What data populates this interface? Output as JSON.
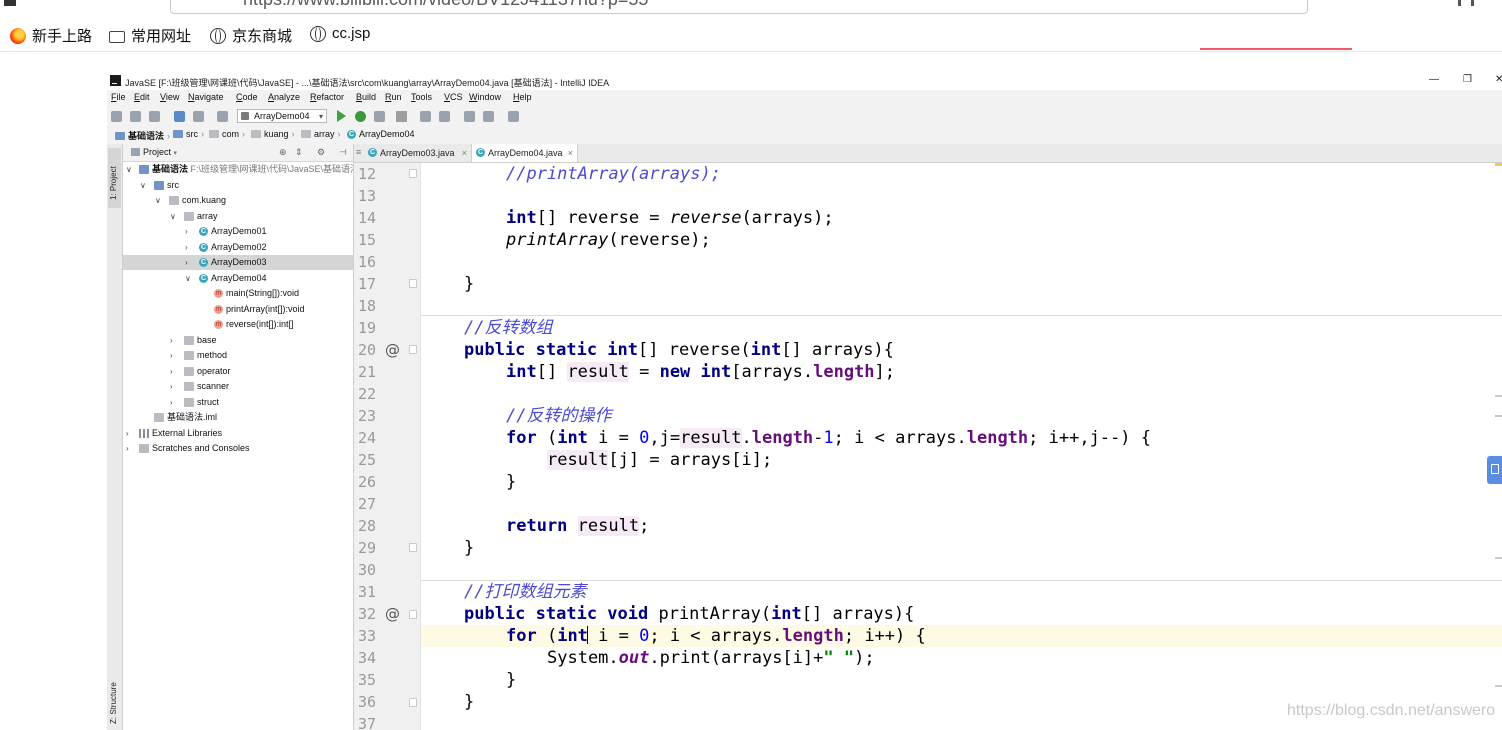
{
  "browser": {
    "url": "https://www.bilibili.com/video/BV12J41137hu?p=55",
    "bookmarks": [
      "新手上路",
      "常用网址",
      "京东商城",
      "cc.jsp"
    ]
  },
  "ide": {
    "title": "JavaSE [F:\\班级管理\\网课班\\代码\\JavaSE] - ...\\基础语法\\src\\com\\kuang\\array\\ArrayDemo04.java [基础语法] - IntelliJ IDEA",
    "window_buttons": [
      "—",
      "❐",
      "✕"
    ],
    "menu": [
      "File",
      "Edit",
      "View",
      "Navigate",
      "Code",
      "Analyze",
      "Refactor",
      "Build",
      "Run",
      "Tools",
      "VCS",
      "Window",
      "Help"
    ],
    "run_config": "ArrayDemo04",
    "breadcrumbs": [
      "基础语法",
      "src",
      "com",
      "kuang",
      "array",
      "ArrayDemo04"
    ],
    "side_tabs": {
      "project": "1: Project",
      "structure": "Z: Structure"
    },
    "project_panel": {
      "title": "Project",
      "root_name": "基础语法",
      "root_path": "F:\\班级管理\\网课班\\代码\\JavaSE\\基础语法",
      "src": "src",
      "package": "com.kuang",
      "array_pkg": "array",
      "classes": [
        "ArrayDemo01",
        "ArrayDemo02",
        "ArrayDemo03",
        "ArrayDemo04"
      ],
      "selected": "ArrayDemo03",
      "methods": [
        "main(String[]):void",
        "printArray(int[]):void",
        "reverse(int[]):int[]"
      ],
      "packages": [
        "base",
        "method",
        "operator",
        "scanner",
        "struct"
      ],
      "iml": "基础语法.iml",
      "external": "External Libraries",
      "scratches": "Scratches and Consoles"
    },
    "tabs": [
      {
        "label": "ArrayDemo03.java",
        "active": false
      },
      {
        "label": "ArrayDemo04.java",
        "active": true
      }
    ],
    "code": {
      "line_numbers": [
        "12",
        "13",
        "14",
        "15",
        "16",
        "17",
        "18",
        "19",
        "20",
        "21",
        "22",
        "23",
        "24",
        "25",
        "26",
        "27",
        "28",
        "29",
        "30",
        "31",
        "32",
        "33",
        "34",
        "35",
        "36",
        "37"
      ],
      "gutter_marks": {
        "20": "@",
        "32": "@"
      }
    }
  },
  "watermark": "https://blog.csdn.net/answero"
}
